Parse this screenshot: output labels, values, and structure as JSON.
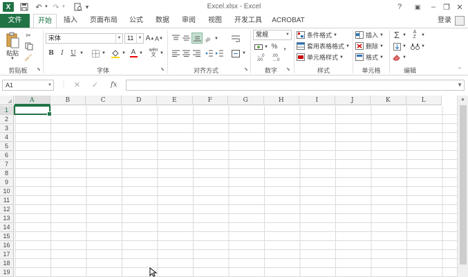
{
  "window": {
    "title": "Excel.xlsx - Excel",
    "help": "?",
    "minimize": "–",
    "restore": "❐",
    "close": "✕"
  },
  "qat": {
    "logo": "X",
    "save_icon": "save-icon",
    "undo_icon": "undo-icon",
    "redo_icon": "redo-icon",
    "preview_icon": "print-preview-icon"
  },
  "tabs": [
    {
      "label": "文件"
    },
    {
      "label": "开始"
    },
    {
      "label": "插入"
    },
    {
      "label": "页面布局"
    },
    {
      "label": "公式"
    },
    {
      "label": "数据"
    },
    {
      "label": "审阅"
    },
    {
      "label": "视图"
    },
    {
      "label": "开发工具"
    },
    {
      "label": "ACROBAT"
    }
  ],
  "login": "登录",
  "ribbon": {
    "clipboard": {
      "label": "剪贴板",
      "paste": "粘贴"
    },
    "font": {
      "label": "字体",
      "family": "宋体",
      "size": "11",
      "bold": "B",
      "italic": "I",
      "underline": "U",
      "grow": "A",
      "shrink": "A",
      "font_color": "A",
      "phonetic": "wén"
    },
    "alignment": {
      "label": "对齐方式"
    },
    "number": {
      "label": "数字",
      "format": "常规",
      "percent": "%",
      "comma": ","
    },
    "styles": {
      "label": "样式",
      "conditional": "条件格式",
      "table": "套用表格格式",
      "cell_styles": "单元格样式"
    },
    "cells": {
      "label": "单元格",
      "insert": "插入",
      "delete": "删除",
      "format": "格式"
    },
    "editing": {
      "label": "编辑"
    }
  },
  "formula_bar": {
    "name_box": "A1",
    "cancel": "✕",
    "enter": "✓",
    "fx": "fx",
    "formula": ""
  },
  "sheet": {
    "columns": [
      "A",
      "B",
      "C",
      "D",
      "E",
      "F",
      "G",
      "H",
      "I",
      "J",
      "K",
      "L"
    ],
    "rows": [
      "1",
      "2",
      "3",
      "4",
      "5",
      "6",
      "7",
      "8",
      "9",
      "10",
      "11",
      "12",
      "13",
      "14",
      "15",
      "16",
      "17",
      "18",
      "19"
    ],
    "selected_cell": "A1"
  },
  "colors": {
    "accent": "#217346",
    "ribbon_text": "#444444"
  }
}
